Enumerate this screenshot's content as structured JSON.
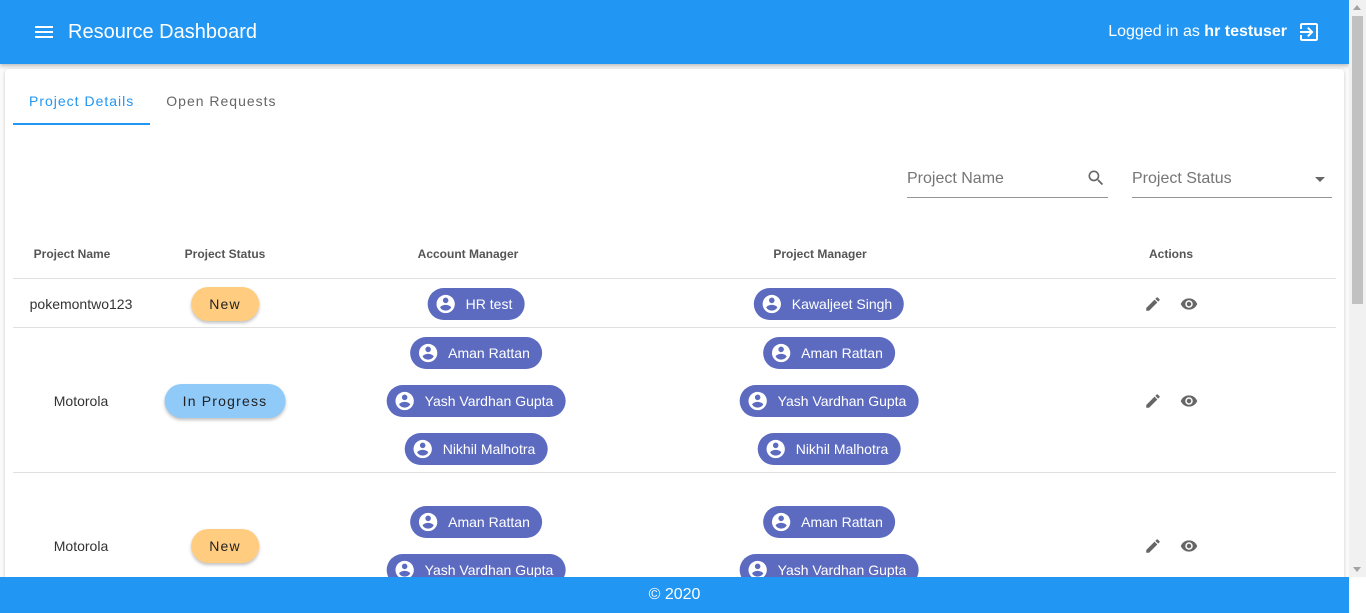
{
  "header": {
    "title": "Resource Dashboard",
    "login_prefix": "Logged in as",
    "username": "hr testuser"
  },
  "tabs": [
    {
      "label": "Project Details",
      "active": true
    },
    {
      "label": "Open Requests",
      "active": false
    }
  ],
  "filters": {
    "search_placeholder": "Project Name",
    "status_placeholder": "Project Status"
  },
  "table": {
    "headers": {
      "name": "Project Name",
      "status": "Project Status",
      "account_manager": "Account Manager",
      "project_manager": "Project Manager",
      "actions": "Actions"
    },
    "rows": [
      {
        "name": "pokemontwo123",
        "status": "New",
        "account_managers": [
          "HR test"
        ],
        "project_managers": [
          "Kawaljeet Singh"
        ]
      },
      {
        "name": "Motorola",
        "status": "In Progress",
        "account_managers": [
          "Aman Rattan",
          "Yash Vardhan Gupta",
          "Nikhil Malhotra"
        ],
        "project_managers": [
          "Aman Rattan",
          "Yash Vardhan Gupta",
          "Nikhil Malhotra"
        ]
      },
      {
        "name": "Motorola",
        "status": "New",
        "account_managers": [
          "Aman Rattan",
          "Yash Vardhan Gupta"
        ],
        "project_managers": [
          "Aman Rattan",
          "Yash Vardhan Gupta"
        ]
      }
    ]
  },
  "footer": {
    "text": "© 2020"
  },
  "colors": {
    "primary": "#2196f3",
    "chip": "#5c6bc0",
    "status_new": "#ffcc80",
    "status_in_progress": "#90caf9"
  },
  "icons": [
    "menu-icon",
    "logout-icon",
    "search-icon",
    "account-circle-icon",
    "edit-icon",
    "visibility-icon"
  ]
}
